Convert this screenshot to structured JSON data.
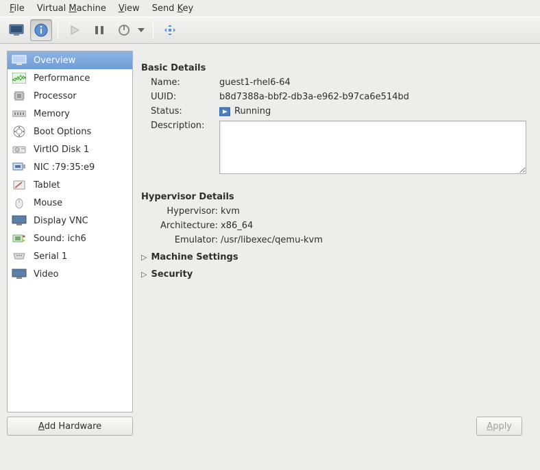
{
  "menu": {
    "file": "File",
    "virtual_machine": "Virtual Machine",
    "view": "View",
    "send_key": "Send Key"
  },
  "toolbar": {
    "console_tip": "Show graphical console",
    "info_tip": "Show virtual hardware details",
    "run_tip": "Run",
    "pause_tip": "Pause",
    "power_tip": "Shut down",
    "fullscreen_tip": "Fullscreen"
  },
  "sidebar": {
    "items": [
      {
        "label": "Overview",
        "icon": "monitor"
      },
      {
        "label": "Performance",
        "icon": "perf"
      },
      {
        "label": "Processor",
        "icon": "cpu"
      },
      {
        "label": "Memory",
        "icon": "mem"
      },
      {
        "label": "Boot Options",
        "icon": "boot"
      },
      {
        "label": "VirtIO Disk 1",
        "icon": "disk"
      },
      {
        "label": "NIC :79:35:e9",
        "icon": "nic"
      },
      {
        "label": "Tablet",
        "icon": "tablet"
      },
      {
        "label": "Mouse",
        "icon": "mouse"
      },
      {
        "label": "Display VNC",
        "icon": "monitor"
      },
      {
        "label": "Sound: ich6",
        "icon": "sound"
      },
      {
        "label": "Serial 1",
        "icon": "serial"
      },
      {
        "label": "Video",
        "icon": "monitor"
      }
    ],
    "selected": 0,
    "add_hardware": "Add Hardware"
  },
  "details": {
    "basic_title": "Basic Details",
    "name_label": "Name:",
    "name_value": "guest1-rhel6-64",
    "uuid_label": "UUID:",
    "uuid_value": "b8d7388a-bbf2-db3a-e962-b97ca6e514bd",
    "status_label": "Status:",
    "status_value": "Running",
    "description_label": "Description:",
    "description_value": "",
    "hypervisor_title": "Hypervisor Details",
    "hypervisor_label": "Hypervisor:",
    "hypervisor_value": "kvm",
    "arch_label": "Architecture:",
    "arch_value": "x86_64",
    "emulator_label": "Emulator:",
    "emulator_value": "/usr/libexec/qemu-kvm",
    "machine_settings": "Machine Settings",
    "security": "Security"
  },
  "footer": {
    "apply": "Apply"
  }
}
